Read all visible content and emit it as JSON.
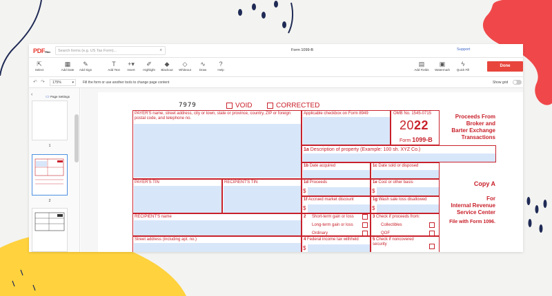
{
  "app": {
    "logo": "PDF",
    "logo_sub": "Filler",
    "search_placeholder": "Search forms (e.g. US Tax Form)...",
    "doc_title": "Form 1099-B",
    "support_label": "Support"
  },
  "toolbar": {
    "tools": [
      {
        "label": "Select",
        "icon": "cursor-icon"
      },
      {
        "label": "Add Date",
        "icon": "calendar-icon"
      },
      {
        "label": "Add Sign",
        "icon": "pen-icon"
      },
      {
        "label": "Add Text",
        "icon": "text-icon"
      },
      {
        "label": "Insert",
        "icon": "plus-icon"
      },
      {
        "label": "Highlight",
        "icon": "highlighter-icon"
      },
      {
        "label": "Blackout",
        "icon": "blackout-icon"
      },
      {
        "label": "Whiteout",
        "icon": "eraser-icon"
      },
      {
        "label": "Draw",
        "icon": "draw-icon"
      },
      {
        "label": "Help",
        "icon": "help-icon"
      },
      {
        "label": "Add Fields",
        "icon": "fields-icon"
      },
      {
        "label": "Watermark",
        "icon": "watermark-icon"
      },
      {
        "label": "Quick Fill",
        "icon": "lightning-icon"
      }
    ],
    "done_label": "Done"
  },
  "subbar": {
    "zoom": "175%",
    "hint": "Fill the form or use another tools to change page content",
    "show_grid_label": "Show grid",
    "show_grid": false
  },
  "pages_panel": {
    "title": "Page Settings",
    "pages": [
      "1",
      "2",
      "3"
    ],
    "selected_page": "2"
  },
  "form": {
    "code": "7979",
    "void_label": "VOID",
    "corrected_label": "CORRECTED",
    "payer_info_label": "PAYER'S name, street address, city or town, state or province, country, ZIP or foreign postal code, and telephone no.",
    "applicable_checkbox_label": "Applicable checkbox on Form 8949",
    "omb": "OMB No. 1545-0715",
    "year_prefix": "20",
    "year_suffix": "22",
    "form_name_prefix": "Form ",
    "form_name": "1099-B",
    "title_lines": [
      "Proceeds From",
      "Broker and",
      "Barter Exchange",
      "Transactions"
    ],
    "box_1a_num": "1a",
    "box_1a": "Description of property (Example: 100 sh. XYZ Co.)",
    "box_1b_num": "1b",
    "box_1b": "Date acquired",
    "box_1c_num": "1c",
    "box_1c": "Date sold or disposed",
    "payer_tin": "PAYER'S TIN",
    "recipient_tin": "RECIPIENT'S TIN",
    "box_1d_num": "1d",
    "box_1d": "Proceeds",
    "box_1e_num": "1e",
    "box_1e": "Cost or other basis",
    "box_1f_num": "1f",
    "box_1f": "Accrued market discount",
    "box_1g_num": "1g",
    "box_1g": "Wash sale loss disallowed",
    "copy_label": "Copy A",
    "for_lines": [
      "For",
      "Internal Revenue",
      "Service Center"
    ],
    "file_with": "File with Form 1096.",
    "recipient_name": "RECIPIENT'S name",
    "box_2_num": "2",
    "box_2_opts": [
      "Short-term gain or loss",
      "Long-term gain or loss",
      "Ordinary"
    ],
    "box_3_num": "3",
    "box_3": "Check if proceeds from:",
    "box_3_opts": [
      "Collectibles",
      "QOF"
    ],
    "street_address": "Street address (including apt. no.)",
    "box_4_num": "4",
    "box_4": "Federal income tax withheld",
    "box_5_num": "5",
    "box_5": "Check if noncovered security",
    "dollar": "$"
  },
  "colors": {
    "form_red": "#c8202a",
    "field_fill": "#d8e6f9",
    "accent": "#e8453c",
    "deco_yellow": "#ffd23e",
    "deco_navy": "#1f2a55"
  }
}
